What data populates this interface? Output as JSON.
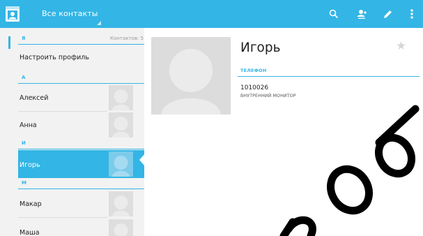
{
  "action_bar": {
    "title": "Все контакты",
    "background": "#33b5e5",
    "icons": [
      "contacts-app-icon",
      "search-icon",
      "add-contact-icon",
      "edit-icon",
      "overflow-menu-icon"
    ]
  },
  "list": {
    "sections": [
      {
        "letter": "Я",
        "count_label": "Контактов: 5"
      },
      {
        "letter": "А"
      },
      {
        "letter": "И"
      },
      {
        "letter": "М"
      }
    ],
    "items": [
      {
        "label": "Настроить профиль"
      },
      {
        "label": "Алексей"
      },
      {
        "label": "Анна"
      },
      {
        "label": "Игорь",
        "selected": true
      },
      {
        "label": "Макар"
      },
      {
        "label": "Маша"
      }
    ]
  },
  "detail": {
    "name": "Игорь",
    "section_title": "ТЕЛЕФОН",
    "phone_number": "1010026",
    "phone_type": "ВНУТРЕННИЙ МОНИТОР",
    "starred": false
  },
  "watermark": "hop",
  "accent_color": "#33b5e5"
}
